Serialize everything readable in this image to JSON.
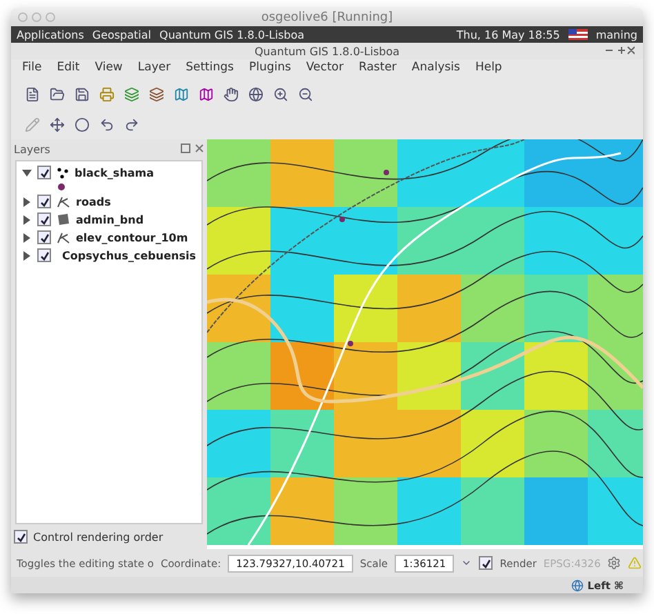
{
  "host_window": {
    "title": "osgeolive6 [Running]"
  },
  "taskbar": {
    "menus": [
      "Applications",
      "Geospatial"
    ],
    "task": "Quantum GIS 1.8.0-Lisboa",
    "clock": "Thu, 16 May  18:55",
    "user": "maning"
  },
  "app_window": {
    "title": "Quantum GIS 1.8.0-Lisboa"
  },
  "menu": [
    "File",
    "Edit",
    "View",
    "Layer",
    "Settings",
    "Plugins",
    "Vector",
    "Raster",
    "Analysis",
    "Help"
  ],
  "layers_panel": {
    "title": "Layers",
    "layers": [
      {
        "name": "black_shama",
        "kind": "point",
        "checked": true,
        "expanded": true
      },
      {
        "name": "roads",
        "kind": "line",
        "checked": true,
        "expanded": false
      },
      {
        "name": "admin_bnd",
        "kind": "polygon",
        "checked": true,
        "expanded": false
      },
      {
        "name": "elev_contour_10m",
        "kind": "line",
        "checked": true,
        "expanded": false
      },
      {
        "name": "Copsychus_cebuensis",
        "kind": "raster",
        "checked": true,
        "expanded": false
      }
    ],
    "control_rendering_order": {
      "label": "Control rendering order",
      "checked": true
    }
  },
  "status_bar": {
    "message": "Toggles the editing state o",
    "coordinate_label": "Coordinate:",
    "coordinate": "123.79327,10.40721",
    "scale_label": "Scale",
    "scale": "1:36121",
    "render": {
      "label": "Render",
      "checked": true
    },
    "crs": "EPSG:4326"
  },
  "bottom_bar": {
    "label": "Left ⌘"
  }
}
